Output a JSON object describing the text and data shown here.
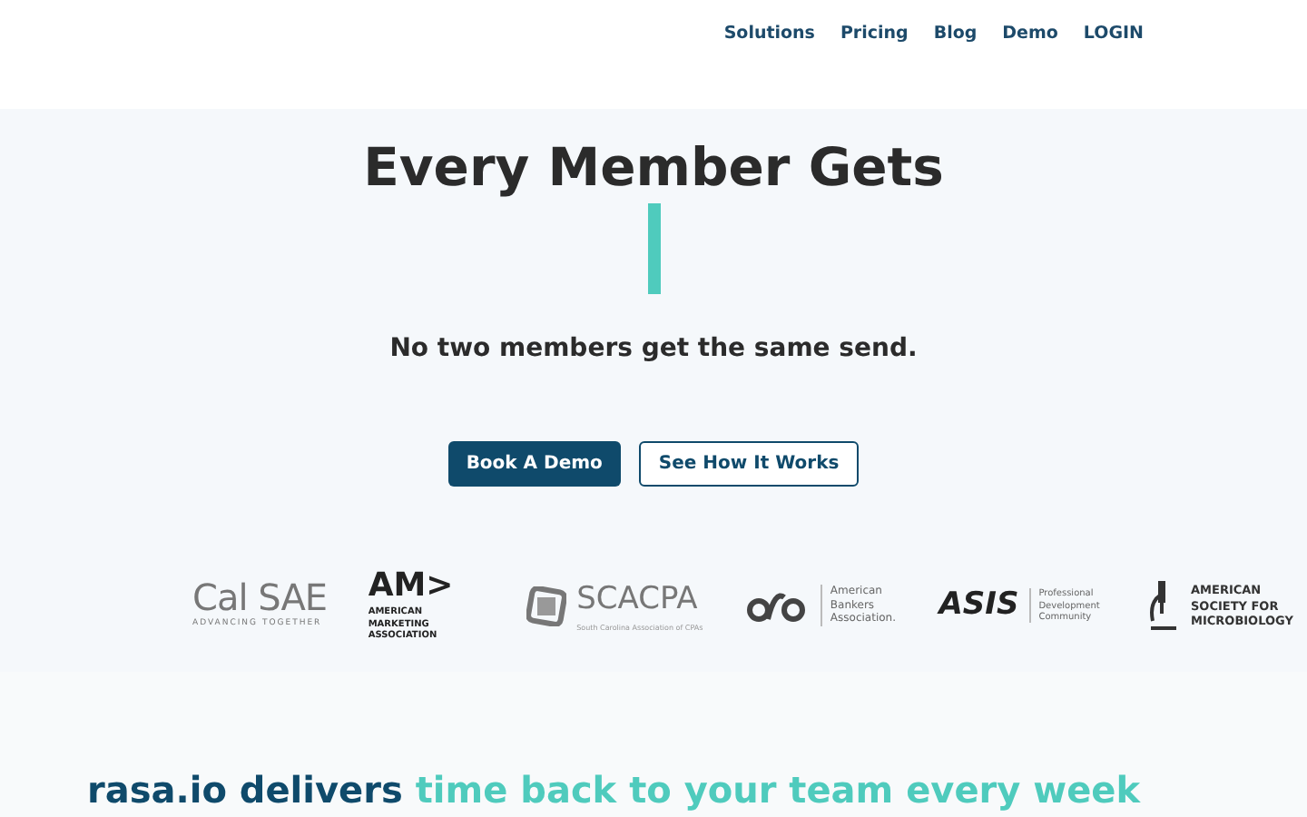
{
  "nav": [
    {
      "label": "Solutions"
    },
    {
      "label": "Pricing"
    },
    {
      "label": "Blog"
    },
    {
      "label": "Demo"
    },
    {
      "label": "LOGIN"
    }
  ],
  "hero": {
    "title": "Every Member Gets",
    "subtitle": "No two members get the same send.",
    "buttons": [
      {
        "label": "Book A Demo",
        "kind": "primary"
      },
      {
        "label": "See How It Works",
        "kind": "outline"
      }
    ]
  },
  "logos": [
    {
      "kind": "calsae",
      "mark": "Cal SAE",
      "text": "ADVANCING TOGETHER"
    },
    {
      "kind": "ama",
      "mark": "AM>",
      "text": "AMERICAN MARKETING ASSOCIATION"
    },
    {
      "kind": "scacpa",
      "mark": "SCACPA",
      "text": "South Carolina Association of CPAs"
    },
    {
      "kind": "aba",
      "text": "American Bankers Association."
    },
    {
      "kind": "asis",
      "mark": "ASIS",
      "text": "Professional Development Community"
    },
    {
      "kind": "asm",
      "text": "AMERICAN SOCIETY FOR MICROBIOLOGY"
    }
  ],
  "section": {
    "lead": "rasa.io delivers",
    "highlight": "time back to your team every week"
  }
}
